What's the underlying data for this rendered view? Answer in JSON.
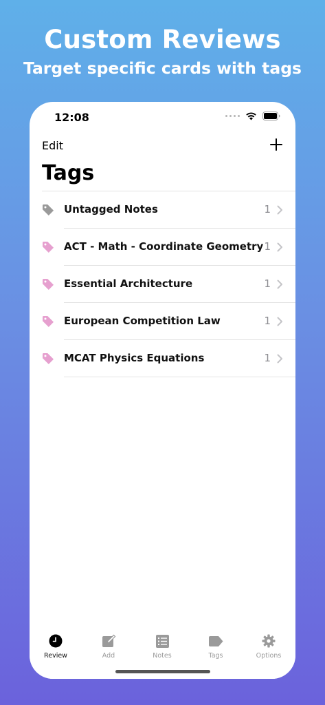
{
  "promo": {
    "title": "Custom Reviews",
    "subtitle": "Target specific cards with tags"
  },
  "status_bar": {
    "time": "12:08",
    "icons": [
      "signal-dots-icon",
      "wifi-icon",
      "battery-icon"
    ]
  },
  "nav": {
    "edit_label": "Edit",
    "add_icon": "plus-icon"
  },
  "page": {
    "title": "Tags"
  },
  "tags": [
    {
      "name": "Untagged Notes",
      "count": "1",
      "icon_color": "#9a9a9a"
    },
    {
      "name": "ACT - Math - Coordinate Geometry",
      "count": "1",
      "icon_color": "#e6a0cf"
    },
    {
      "name": "Essential Architecture",
      "count": "1",
      "icon_color": "#e6a0cf"
    },
    {
      "name": "European Competition Law",
      "count": "1",
      "icon_color": "#e6a0cf"
    },
    {
      "name": "MCAT Physics Equations",
      "count": "1",
      "icon_color": "#e6a0cf"
    }
  ],
  "tabbar": {
    "items": [
      {
        "label": "Review",
        "icon": "clock-icon",
        "active": true
      },
      {
        "label": "Add",
        "icon": "compose-icon",
        "active": false
      },
      {
        "label": "Notes",
        "icon": "list-icon",
        "active": false
      },
      {
        "label": "Tags",
        "icon": "tag-icon",
        "active": false
      },
      {
        "label": "Options",
        "icon": "gear-icon",
        "active": false
      }
    ]
  },
  "colors": {
    "background_top": "#5fb0e9",
    "background_bottom": "#6b62dc",
    "tag_pink": "#e6a0cf",
    "tag_gray": "#9a9a9a",
    "secondary_text": "#8e8e93",
    "inactive_tab": "#9a9a9a"
  }
}
